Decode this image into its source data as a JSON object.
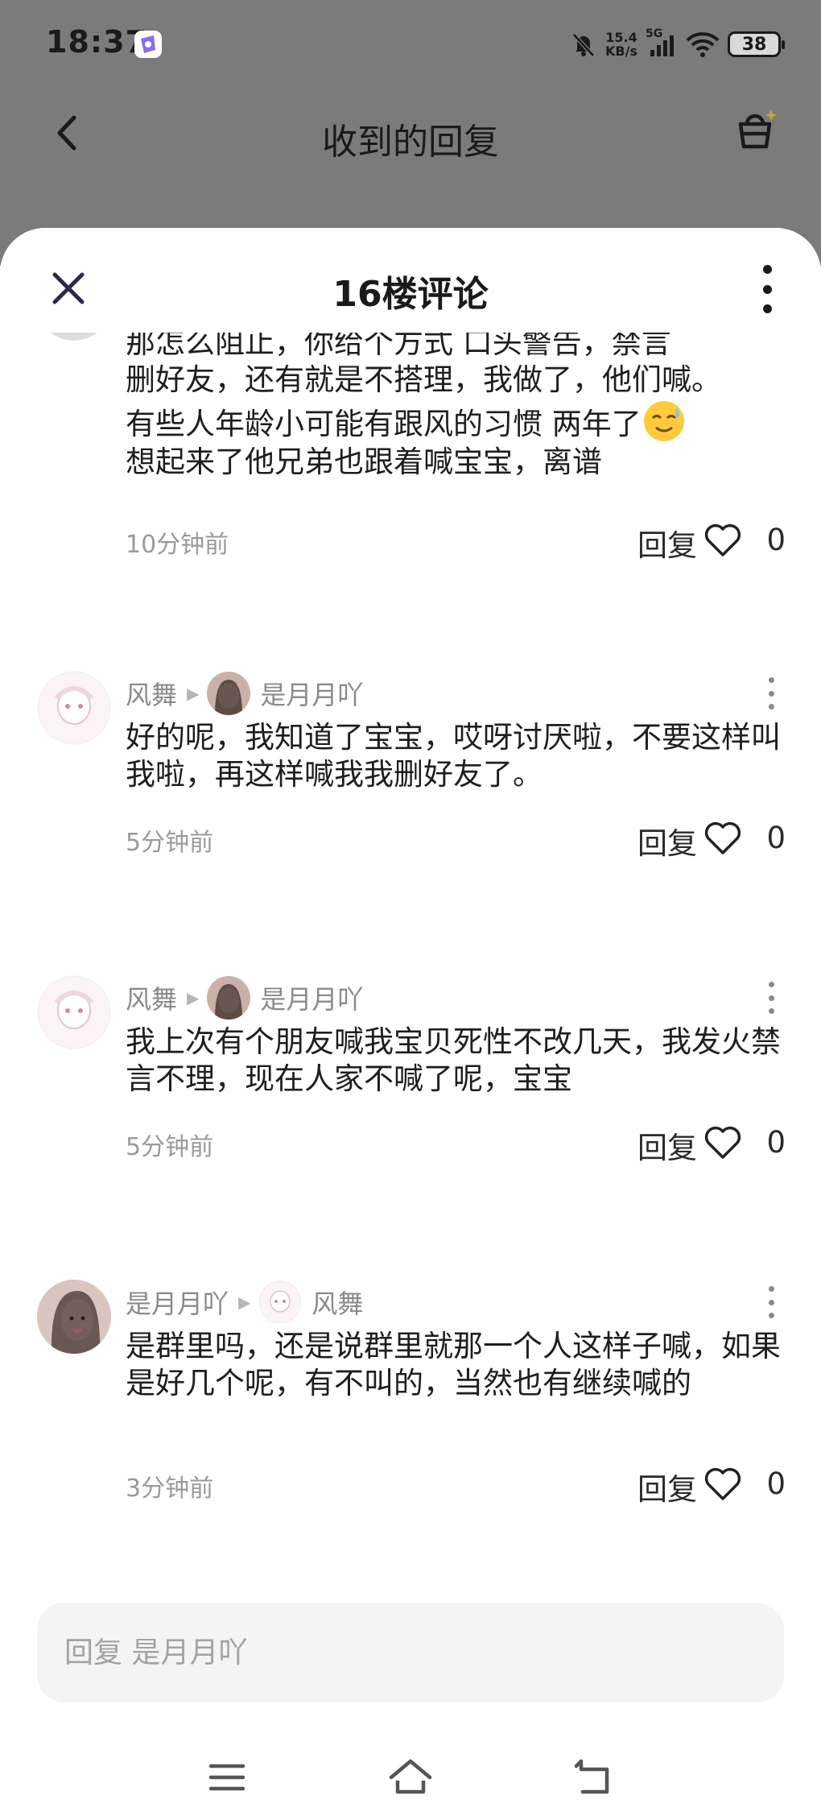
{
  "status_bar": {
    "time": "18:37",
    "net_speed_value": "15.4",
    "net_speed_unit": "KB/s",
    "signal_label": "5G",
    "battery": "38"
  },
  "nav": {
    "title": "收到的回复"
  },
  "sheet": {
    "title": "16楼评论"
  },
  "comments": [
    {
      "text_lines": [
        "那怎么阻止，你给个方式 口头警告，禁言",
        "删好友，还有就是不搭理，我做了，他们喊。",
        "有些人年龄小可能有跟风的习惯 两年了",
        "想起来了他兄弟也跟着喊宝宝，离谱"
      ],
      "emoji": "sweat-smile-emoji",
      "time_ago": "10分钟前",
      "reply_label": "回复",
      "likes": "0"
    },
    {
      "author": "风舞",
      "reply_to": "是月月吖",
      "text": "好的呢，我知道了宝宝，哎呀讨厌啦，不要这样叫我啦，再这样喊我我删好友了。",
      "time_ago": "5分钟前",
      "reply_label": "回复",
      "likes": "0"
    },
    {
      "author": "风舞",
      "reply_to": "是月月吖",
      "text": "我上次有个朋友喊我宝贝死性不改几天，我发火禁言不理，现在人家不喊了呢，宝宝",
      "time_ago": "5分钟前",
      "reply_label": "回复",
      "likes": "0"
    },
    {
      "author": "是月月吖",
      "reply_to": "风舞",
      "text": "是群里吗，还是说群里就那一个人这样子喊，如果是好几个呢，有不叫的，当然也有继续喊的",
      "time_ago": "3分钟前",
      "reply_label": "回复",
      "likes": "0"
    }
  ],
  "input": {
    "placeholder": "回复 是月月吖"
  },
  "colors": {
    "dim_overlay": "#7b7b7b",
    "sheet_bg": "#ffffff",
    "input_bg": "#f4f4f6",
    "meta_gray": "#9a9a9a"
  }
}
